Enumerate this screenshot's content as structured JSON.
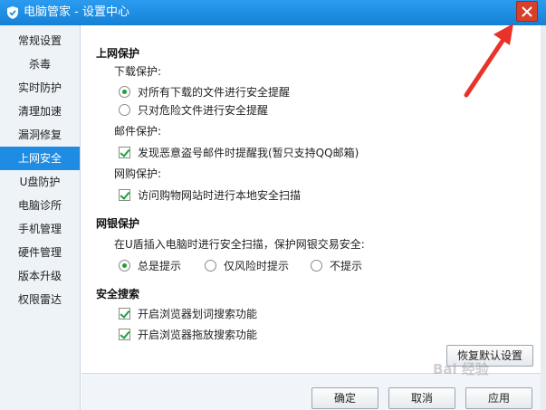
{
  "window": {
    "title": "电脑管家 - 设置中心",
    "close_tooltip": "关闭",
    "app_icon": "shield-icon",
    "close_icon": "close-icon"
  },
  "sidebar": {
    "items": [
      {
        "label": "常规设置",
        "active": false
      },
      {
        "label": "杀毒",
        "active": false
      },
      {
        "label": "实时防护",
        "active": false
      },
      {
        "label": "清理加速",
        "active": false
      },
      {
        "label": "漏洞修复",
        "active": false
      },
      {
        "label": "上网安全",
        "active": true
      },
      {
        "label": "U盘防护",
        "active": false
      },
      {
        "label": "电脑诊所",
        "active": false
      },
      {
        "label": "手机管理",
        "active": false
      },
      {
        "label": "硬件管理",
        "active": false
      },
      {
        "label": "版本升级",
        "active": false
      },
      {
        "label": "权限雷达",
        "active": false
      }
    ]
  },
  "internet_protection": {
    "heading": "上网保护",
    "download": {
      "label": "下载保护:",
      "options": [
        {
          "label": "对所有下载的文件进行安全提醒",
          "selected": true
        },
        {
          "label": "只对危险文件进行安全提醒",
          "selected": false
        }
      ]
    },
    "mail": {
      "label": "邮件保护:",
      "option": {
        "label": "发现恶意盗号邮件时提醒我(暂只支持QQ邮箱)",
        "checked": true
      }
    },
    "shopping": {
      "label": "网购保护:",
      "option": {
        "label": "访问购物网站时进行本地安全扫描",
        "checked": true
      }
    }
  },
  "bank_protection": {
    "heading": "网银保护",
    "description": "在U盾插入电脑时进行安全扫描，保护网银交易安全:",
    "options": [
      {
        "label": "总是提示",
        "selected": true
      },
      {
        "label": "仅风险时提示",
        "selected": false
      },
      {
        "label": "不提示",
        "selected": false
      }
    ]
  },
  "safe_search": {
    "heading": "安全搜索",
    "options": [
      {
        "label": "开启浏览器划词搜索功能",
        "checked": true
      },
      {
        "label": "开启浏览器拖放搜索功能",
        "checked": true
      }
    ]
  },
  "buttons": {
    "restore": "恢复默认设置",
    "ok": "确定",
    "cancel": "取消",
    "apply": "应用"
  },
  "watermark": "Bai 经验",
  "colors": {
    "titlebar": "#1e8fe0",
    "active_sidebar": "#1f8ce3",
    "check_green": "#1aa13a",
    "close_red": "#d9402b",
    "annotation_red": "#e8322a"
  }
}
